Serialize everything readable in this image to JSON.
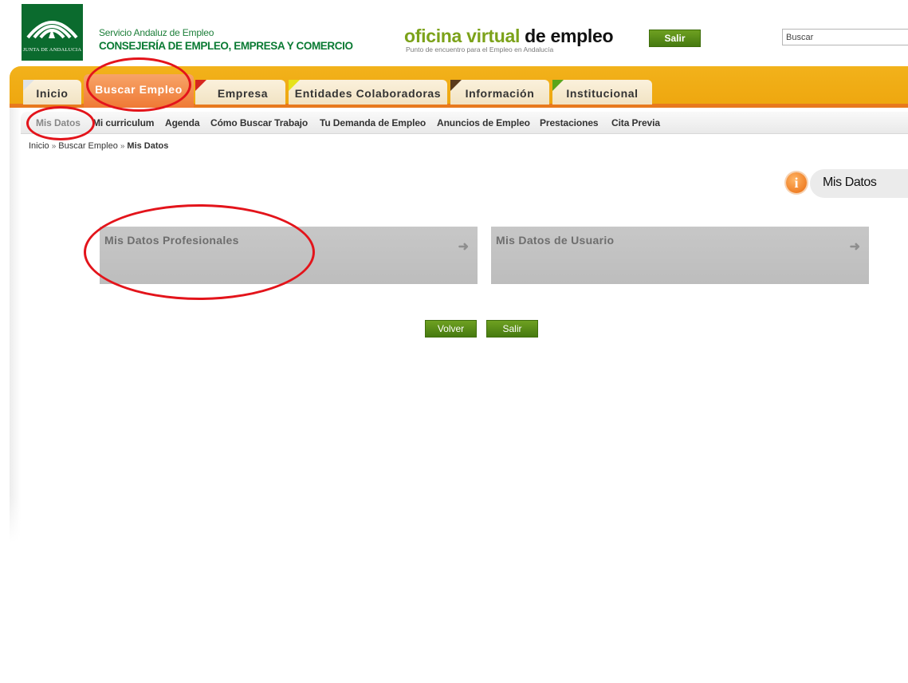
{
  "header": {
    "logo_text": "JUNTA DE ANDALUCIA",
    "service_name": "Servicio Andaluz de Empleo",
    "ministry_name": "CONSEJERÍA DE EMPLEO, EMPRESA Y COMERCIO",
    "brand_part1": "oficina virtual",
    "brand_part2": "de empleo",
    "brand_tagline": "Punto de encuentro para el Empleo en Andalucía",
    "exit_label": "Salir",
    "search_value": "Buscar"
  },
  "tabs": [
    {
      "label": "Inicio",
      "corner_color": "#dfe3e6",
      "active": false
    },
    {
      "label": "Buscar Empleo",
      "corner_color": "",
      "active": true
    },
    {
      "label": "Empresa",
      "corner_color": "#d6271f",
      "active": false
    },
    {
      "label": "Entidades Colaboradoras",
      "corner_color": "#e6e21a",
      "active": false
    },
    {
      "label": "Información",
      "corner_color": "#5a3a1c",
      "active": false
    },
    {
      "label": "Institucional",
      "corner_color": "#5aa51a",
      "active": false
    }
  ],
  "subnav": [
    {
      "label": "Mis Datos",
      "active": true
    },
    {
      "label": "Mi curriculum",
      "active": false
    },
    {
      "label": "Agenda",
      "active": false
    },
    {
      "label": "Cómo Buscar Trabajo",
      "active": false
    },
    {
      "label": "Tu Demanda de Empleo",
      "active": false
    },
    {
      "label": "Anuncios de Empleo",
      "active": false
    },
    {
      "label": "Prestaciones",
      "active": false
    },
    {
      "label": "Cita Previa",
      "active": false
    }
  ],
  "breadcrumb": {
    "items": [
      "Inicio",
      "Buscar Empleo"
    ],
    "separator": "»",
    "current": "Mis Datos"
  },
  "page_title": "Mis Datos",
  "info_icon_glyph": "i",
  "cards": [
    {
      "label": "Mis Datos Profesionales",
      "arrow": "➜"
    },
    {
      "label": "Mis Datos de Usuario",
      "arrow": "➜"
    }
  ],
  "actions": {
    "back_label": "Volver",
    "exit_label": "Salir"
  },
  "colors": {
    "accent_orange": "#f2b21b",
    "active_tab": "#ef7a35",
    "button_green": "#5a8e18",
    "brand_green": "#0b6b2e",
    "annotation_red": "#e3141b"
  }
}
